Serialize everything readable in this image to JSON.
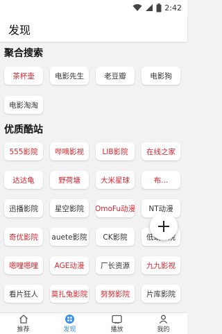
{
  "status": {
    "time": "2:42"
  },
  "header": {
    "title": "发现"
  },
  "sections": [
    {
      "title": "聚合搜索"
    },
    {
      "title": "优质酷站"
    }
  ],
  "search_sites": [
    {
      "label": "茶杯壶",
      "color": "#d8242c"
    },
    {
      "label": "电影先生",
      "color": "#333333"
    },
    {
      "label": "老豆瓣",
      "color": "#333333"
    },
    {
      "label": "电影狗",
      "color": "#333333"
    },
    {
      "label": "电影淘淘",
      "color": "#333333"
    }
  ],
  "sites": [
    {
      "label": "555影院",
      "color": "#d8242c"
    },
    {
      "label": "哔嘀影视",
      "color": "#d8242c"
    },
    {
      "label": "LIB影院",
      "color": "#d8242c"
    },
    {
      "label": "在线之家",
      "color": "#d8242c"
    },
    {
      "label": "达达龟",
      "color": "#d8242c"
    },
    {
      "label": "野荷塘",
      "color": "#d8242c"
    },
    {
      "label": "大米星球",
      "color": "#d8242c"
    },
    {
      "label": "布...",
      "color": "#d8242c"
    },
    {
      "label": "迅播影院",
      "color": "#333333"
    },
    {
      "label": "星空影院",
      "color": "#333333"
    },
    {
      "label": "OmoFu动漫",
      "color": "#d8242c"
    },
    {
      "label": "NT动漫",
      "color": "#333333"
    },
    {
      "label": "奇优影院",
      "color": "#d8242c"
    },
    {
      "label": "auete影院",
      "color": "#333333"
    },
    {
      "label": "CK影院",
      "color": "#333333"
    },
    {
      "label": "低端影院",
      "color": "#333333"
    },
    {
      "label": "嗯哩嗯哩",
      "color": "#d8242c"
    },
    {
      "label": "AGE动漫",
      "color": "#d8242c"
    },
    {
      "label": "厂长资源",
      "color": "#333333"
    },
    {
      "label": "九九影视",
      "color": "#d8242c"
    },
    {
      "label": "看片狂人",
      "color": "#333333"
    },
    {
      "label": "莫扎兔影院",
      "color": "#d8242c"
    },
    {
      "label": "努努影院",
      "color": "#d8242c"
    },
    {
      "label": "片库影院",
      "color": "#333333"
    }
  ],
  "fab": {
    "icon": "plus-icon"
  },
  "bottom_nav": [
    {
      "label": "推荐",
      "icon": "home-icon",
      "active": false
    },
    {
      "label": "发现",
      "icon": "grid-icon",
      "active": true
    },
    {
      "label": "播放",
      "icon": "play-icon",
      "active": false
    },
    {
      "label": "我的",
      "icon": "user-icon",
      "active": false
    }
  ],
  "colors": {
    "accent": "#3a8ee6",
    "highlight": "#d8242c"
  }
}
